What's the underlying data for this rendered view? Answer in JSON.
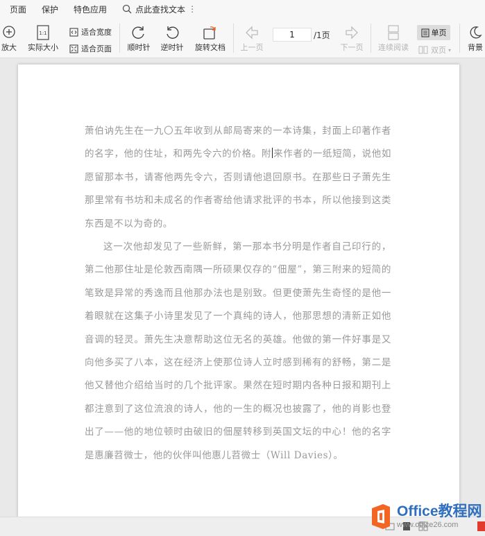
{
  "menu": {
    "items": [
      "页面",
      "保护",
      "特色应用"
    ],
    "search_label": "点此查找文本",
    "more": "⋮"
  },
  "toolbar": {
    "zoom_in": "放大",
    "actual_size": "实际大小",
    "fit_width": "适合宽度",
    "fit_page": "适合页面",
    "rotate_cw": "顺时针",
    "rotate_ccw": "逆时针",
    "rotate_doc": "旋转文档",
    "prev_page": "上一页",
    "current_page": "1",
    "total_pages": "/1页",
    "next_page": "下一页",
    "continuous": "连续阅读",
    "single": "单页",
    "double": "双页",
    "background": "背景"
  },
  "document": {
    "p1_a": "萧伯讷先生在一九〇五年收到从邮局寄来的一本诗集，封面上印著作者的名字，他的住址，和两先令六的价格。附",
    "p1_b": "来作者的一纸短简，说他如愿留那本书，请寄他两先令六，否则请他退回原书。在那些日子萧先生那里常有书坊和未成名的作者寄给他请求批评的书本，所以他接到这类东西是不以为奇的。",
    "p2": "这一次他却发见了一些新鲜，第一那本书分明是作者自己印行的，第二他那住址是伦敦西南隅一所硕果仅存的“佃屋”，第三附来的短简的笔致是异常的秀逸而且他那办法也是别致。但更使萧先生奇怪的是他一着眼就在这集子小诗里发见了一个真纯的诗人，他那思想的清新正如他音调的轻灵。萧先生决意帮助这位无名的英雄。他做的第一件好事是又向他多买了八本，这在经济上使那位诗人立时感到稀有的舒畅，第二是他又替他介绍给当时的几个批评家。果然在短时期内各种日报和期刊上都注意到了这位流浪的诗人，他的一生的概况也披露了，他的肖影也登出了——他的地位顿时由破旧的佃屋转移到英国文坛的中心！他的名字是惠廉苕微士，他的伙伴叫他惠儿苕微士（Will Davies）。"
  },
  "watermark": {
    "title": "Office教程网",
    "url": "www.office26.com"
  },
  "colors": {
    "accent_orange": "#f26522",
    "brand_blue": "#2f6fbd",
    "body_text": "#999999"
  }
}
